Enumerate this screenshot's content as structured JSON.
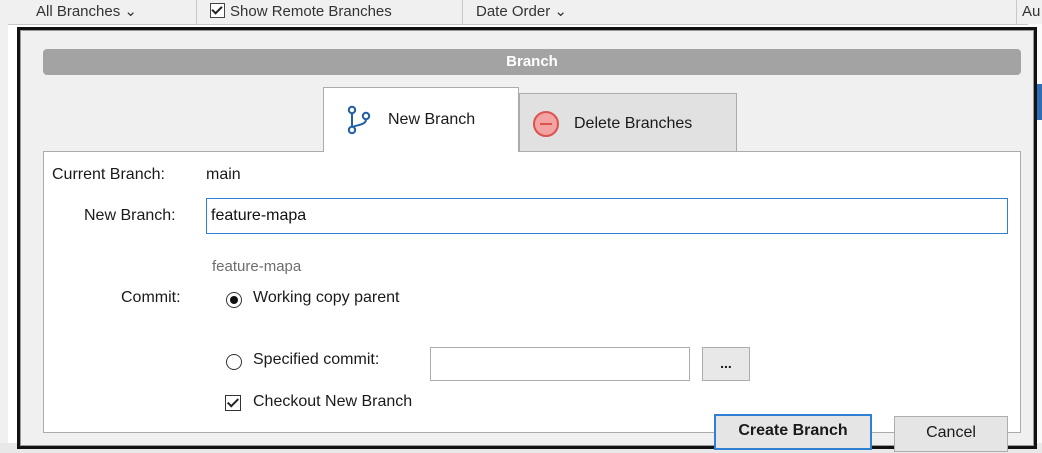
{
  "background": {
    "branches_filter": "All Branches",
    "show_remote_label": "Show Remote Branches",
    "order_label": "Date Order",
    "author_partial": "Au"
  },
  "dialog": {
    "title": "Branch",
    "tabs": [
      {
        "label": "New Branch",
        "icon": "branch-icon",
        "active": true
      },
      {
        "label": "Delete Branches",
        "icon": "minus-circle-icon",
        "active": false
      }
    ],
    "current_branch_label": "Current Branch:",
    "current_branch_value": "main",
    "new_branch_label": "New Branch:",
    "new_branch_value": "feature-mapa",
    "branch_preview": "feature-mapa",
    "commit_label": "Commit:",
    "commit_options": [
      {
        "label": "Working copy parent",
        "selected": true
      },
      {
        "label": "Specified commit:",
        "selected": false
      }
    ],
    "specified_commit_value": "",
    "browse_label": "...",
    "checkout_label": "Checkout New Branch",
    "checkout_checked": true,
    "create_button": "Create Branch",
    "cancel_button": "Cancel"
  },
  "colors": {
    "accent": "#2f7fd2",
    "title_bar": "#a3a3a3",
    "delete_icon_fill": "#f4a3a3",
    "delete_icon_stroke": "#d9534f",
    "branch_icon": "#1f5fa8"
  }
}
